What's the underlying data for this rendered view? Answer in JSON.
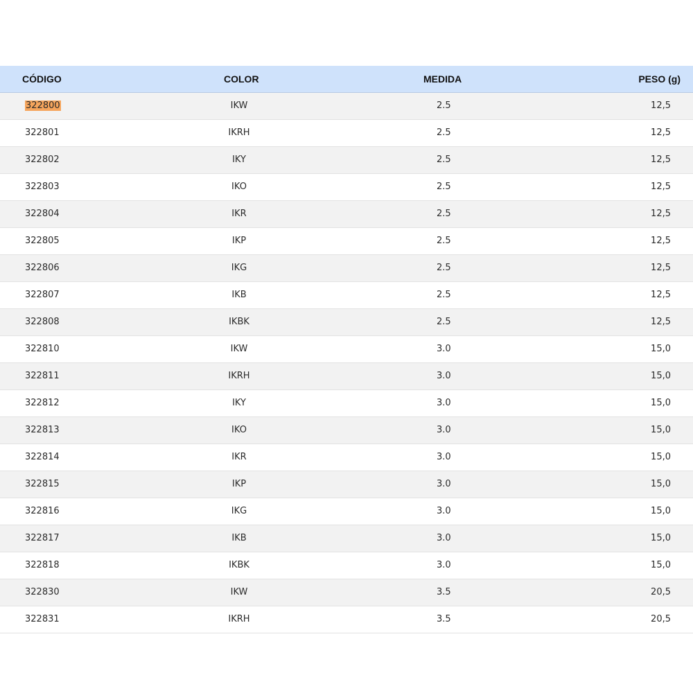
{
  "table": {
    "headers": {
      "codigo": "CÓDIGO",
      "color": "COLOR",
      "medida": "MEDIDA",
      "peso": "PESO (g)"
    },
    "rows": [
      {
        "codigo": "322800",
        "color": "IKW",
        "medida": "2.5",
        "peso": "12,5"
      },
      {
        "codigo": "322801",
        "color": "IKRH",
        "medida": "2.5",
        "peso": "12,5"
      },
      {
        "codigo": "322802",
        "color": "IKY",
        "medida": "2.5",
        "peso": "12,5"
      },
      {
        "codigo": "322803",
        "color": "IKO",
        "medida": "2.5",
        "peso": "12,5"
      },
      {
        "codigo": "322804",
        "color": "IKR",
        "medida": "2.5",
        "peso": "12,5"
      },
      {
        "codigo": "322805",
        "color": "IKP",
        "medida": "2.5",
        "peso": "12,5"
      },
      {
        "codigo": "322806",
        "color": "IKG",
        "medida": "2.5",
        "peso": "12,5"
      },
      {
        "codigo": "322807",
        "color": "IKB",
        "medida": "2.5",
        "peso": "12,5"
      },
      {
        "codigo": "322808",
        "color": "IKBK",
        "medida": "2.5",
        "peso": "12,5"
      },
      {
        "codigo": "322810",
        "color": "IKW",
        "medida": "3.0",
        "peso": "15,0"
      },
      {
        "codigo": "322811",
        "color": "IKRH",
        "medida": "3.0",
        "peso": "15,0"
      },
      {
        "codigo": "322812",
        "color": "IKY",
        "medida": "3.0",
        "peso": "15,0"
      },
      {
        "codigo": "322813",
        "color": "IKO",
        "medida": "3.0",
        "peso": "15,0"
      },
      {
        "codigo": "322814",
        "color": "IKR",
        "medida": "3.0",
        "peso": "15,0"
      },
      {
        "codigo": "322815",
        "color": "IKP",
        "medida": "3.0",
        "peso": "15,0"
      },
      {
        "codigo": "322816",
        "color": "IKG",
        "medida": "3.0",
        "peso": "15,0"
      },
      {
        "codigo": "322817",
        "color": "IKB",
        "medida": "3.0",
        "peso": "15,0"
      },
      {
        "codigo": "322818",
        "color": "IKBK",
        "medida": "3.0",
        "peso": "15,0"
      },
      {
        "codigo": "322830",
        "color": "IKW",
        "medida": "3.5",
        "peso": "20,5"
      },
      {
        "codigo": "322831",
        "color": "IKRH",
        "medida": "3.5",
        "peso": "20,5"
      }
    ],
    "highlighted_row_index": 0
  },
  "colors": {
    "header_bg": "#cfe2fb",
    "stripe_bg": "#f2f2f2",
    "highlight": "#f6a55c"
  }
}
